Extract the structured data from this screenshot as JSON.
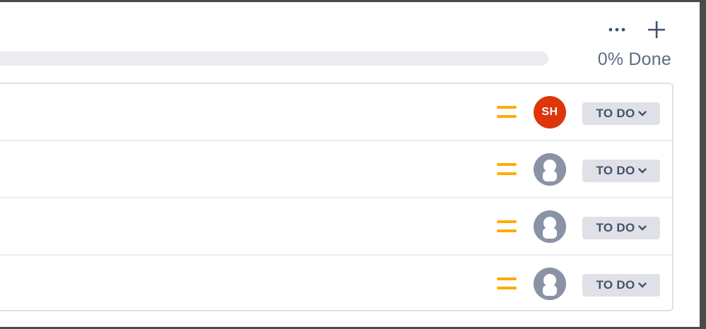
{
  "header": {
    "more_icon": "ellipsis-icon",
    "add_icon": "plus-icon",
    "progress_percent": 0,
    "progress_label": "0% Done"
  },
  "rows": [
    {
      "priority_icon": "priority-medium-icon",
      "assignee": {
        "type": "initials",
        "initials": "SH",
        "color": "#de350b"
      },
      "status": "TO DO"
    },
    {
      "priority_icon": "priority-medium-icon",
      "assignee": {
        "type": "unassigned"
      },
      "status": "TO DO"
    },
    {
      "priority_icon": "priority-medium-icon",
      "assignee": {
        "type": "unassigned"
      },
      "status": "TO DO"
    },
    {
      "priority_icon": "priority-medium-icon",
      "assignee": {
        "type": "unassigned"
      },
      "status": "TO DO"
    }
  ],
  "colors": {
    "priority": "#ffab00",
    "status_bg": "#dfe1e6",
    "progress_track": "#ebecf0"
  }
}
